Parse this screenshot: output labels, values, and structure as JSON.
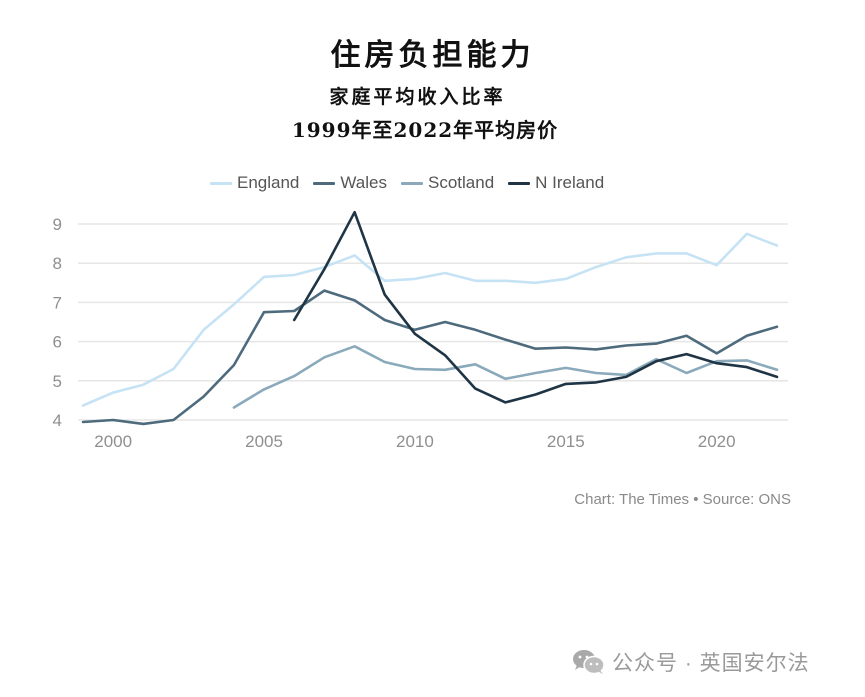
{
  "header": {
    "title": "住房负担能力",
    "subtitle_line1": "家庭平均收入比率",
    "subtitle_line2": "1999年至2022年平均房价"
  },
  "footer": {
    "credit": "Chart: The Times • Source: ONS",
    "watermark_icon": "wechat-icon",
    "watermark_text": "公众号 · 英国安尔法"
  },
  "chart_data": {
    "type": "line",
    "title": "住房负担能力",
    "subtitle": "家庭平均收入比率 1999年至2022年平均房价",
    "xlabel": "",
    "ylabel": "",
    "x": [
      1999,
      2000,
      2001,
      2002,
      2003,
      2004,
      2005,
      2006,
      2007,
      2008,
      2009,
      2010,
      2011,
      2012,
      2013,
      2014,
      2015,
      2016,
      2017,
      2018,
      2019,
      2020,
      2021,
      2022
    ],
    "xlim": [
      1999,
      2022
    ],
    "ylim": [
      4,
      9.3
    ],
    "x_ticks": [
      2000,
      2005,
      2010,
      2015,
      2020
    ],
    "y_ticks": [
      4,
      5,
      6,
      7,
      8,
      9
    ],
    "grid": "horizontal",
    "legend_position": "top-center",
    "series": [
      {
        "name": "England",
        "color": "#c6e3f5",
        "values": [
          4.37,
          4.7,
          4.9,
          5.3,
          6.3,
          6.95,
          7.65,
          7.7,
          7.9,
          8.2,
          7.55,
          7.6,
          7.75,
          7.55,
          7.55,
          7.5,
          7.6,
          7.9,
          8.15,
          8.25,
          8.25,
          7.95,
          8.75,
          8.45
        ]
      },
      {
        "name": "Wales",
        "color": "#4e6b7d",
        "values": [
          3.95,
          4.0,
          3.9,
          4.0,
          4.6,
          5.4,
          6.75,
          6.78,
          7.3,
          7.05,
          6.55,
          6.3,
          6.5,
          6.3,
          6.05,
          5.82,
          5.85,
          5.8,
          5.9,
          5.95,
          6.15,
          5.7,
          6.15,
          6.38
        ]
      },
      {
        "name": "Scotland",
        "color": "#8aaabb",
        "values": [
          null,
          null,
          null,
          null,
          null,
          4.32,
          4.78,
          5.12,
          5.6,
          5.88,
          5.48,
          5.3,
          5.28,
          5.42,
          5.05,
          5.2,
          5.33,
          5.2,
          5.15,
          5.55,
          5.2,
          5.5,
          5.52,
          5.28
        ]
      },
      {
        "name": "N Ireland",
        "color": "#1f3545",
        "values": [
          null,
          null,
          null,
          null,
          null,
          null,
          null,
          6.55,
          7.85,
          9.3,
          7.2,
          6.2,
          5.65,
          4.8,
          4.45,
          4.65,
          4.92,
          4.96,
          5.1,
          5.5,
          5.68,
          5.45,
          5.35,
          5.1
        ]
      }
    ]
  }
}
